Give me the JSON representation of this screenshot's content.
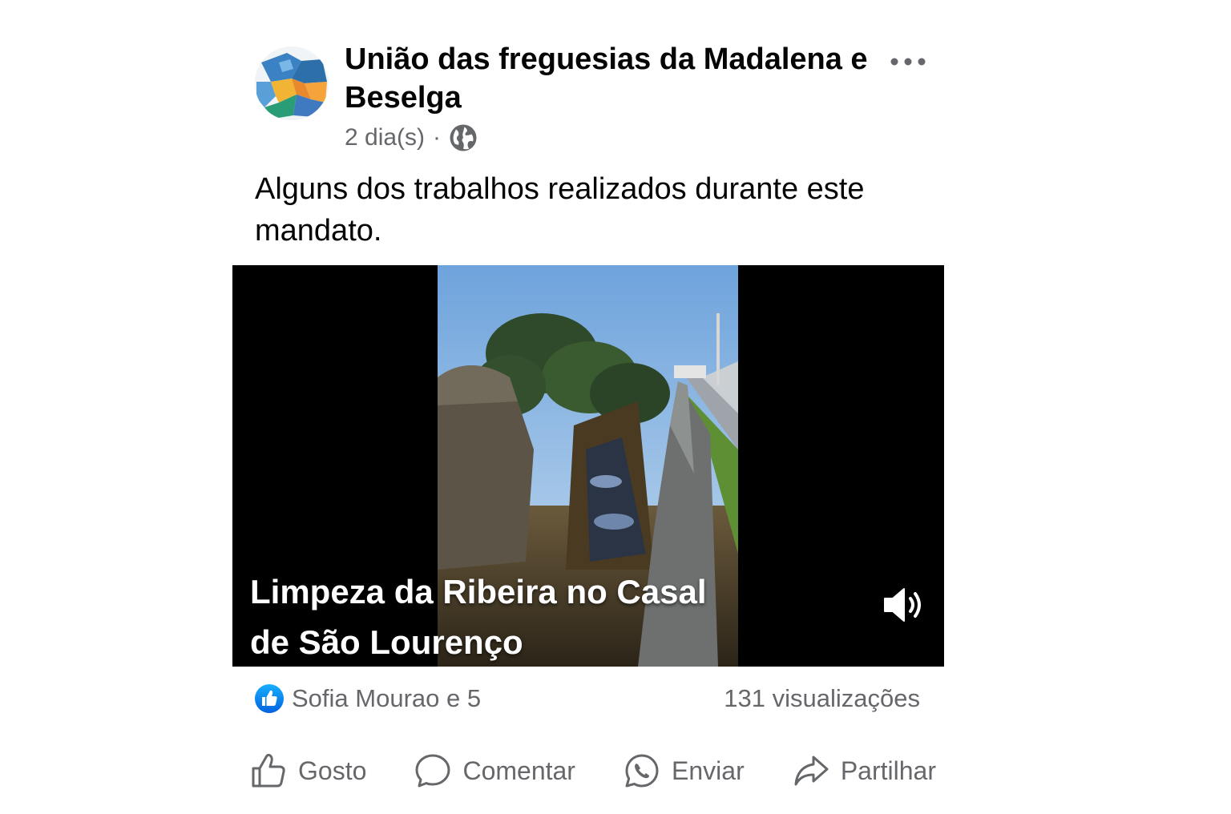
{
  "post": {
    "page_name": "União das freguesias  da Madalena e Beselga",
    "time": "2 dia(s)",
    "separator": "·",
    "audience_icon": "globe-icon",
    "more_icon": "more-options-icon",
    "caption": "Alguns dos trabalhos realizados durante este mandato."
  },
  "video": {
    "overlay_title": "Limpeza da Ribeira no Casal de São Lourenço",
    "sound_icon": "volume-icon"
  },
  "stats": {
    "reactions": "Sofia Mourao e 5",
    "views": "131 visualizações",
    "reaction_icon": "like-reaction-icon"
  },
  "actions": [
    {
      "label": "Gosto",
      "icon": "thumbs-up-icon"
    },
    {
      "label": "Comentar",
      "icon": "comment-icon"
    },
    {
      "label": "Enviar",
      "icon": "whatsapp-icon"
    },
    {
      "label": "Partilhar",
      "icon": "share-icon"
    }
  ],
  "colors": {
    "text_primary": "#050505",
    "text_secondary": "#65676b",
    "like_blue": "#1877f2",
    "video_bg": "#000000"
  }
}
